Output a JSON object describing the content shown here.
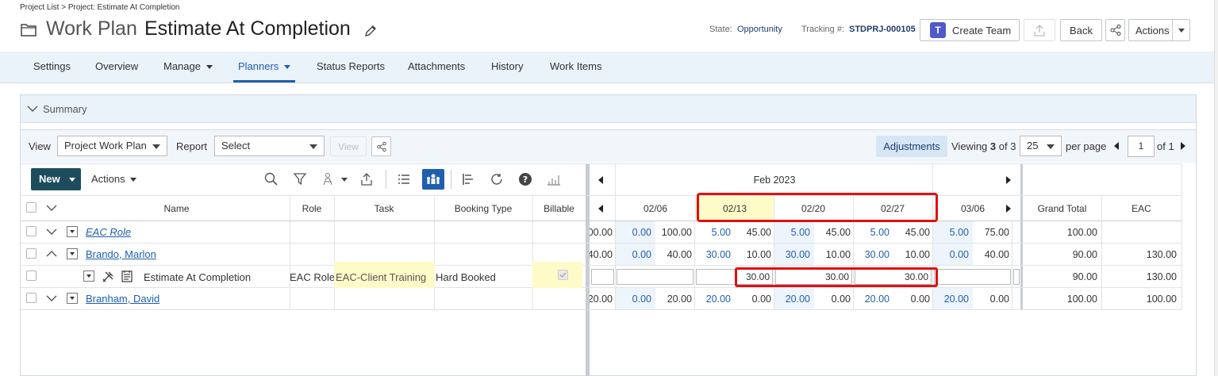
{
  "breadcrumb": "Project List > Project: Estimate At Completion",
  "header": {
    "section": "Work Plan",
    "title": "Estimate At Completion",
    "state_label": "State:",
    "state_value": "Opportunity",
    "tracking_label": "Tracking #:",
    "tracking_value": "STDPRJ-000105",
    "create_team": "Create Team",
    "back": "Back",
    "actions": "Actions"
  },
  "tabs": [
    "Settings",
    "Overview",
    "Manage",
    "Planners",
    "Status Reports",
    "Attachments",
    "History",
    "Work Items"
  ],
  "active_tab": "Planners",
  "summary_label": "Summary",
  "toolbar": {
    "view_label": "View",
    "view_value": "Project Work Plan",
    "report_label": "Report",
    "report_value": "Select",
    "view_button": "View",
    "adjustments": "Adjustments",
    "viewing_prefix": "Viewing ",
    "viewing_current": "3",
    "viewing_suffix": " of 3",
    "per_page_value": "25",
    "per_page_label": "per page",
    "page_value": "1",
    "page_of": "of 1"
  },
  "grid_toolbar": {
    "new": "New",
    "actions": "Actions"
  },
  "columns": {
    "name": "Name",
    "role": "Role",
    "task": "Task",
    "booking_type": "Booking Type",
    "billable": "Billable"
  },
  "timeline": {
    "month": "Feb 2023",
    "weeks": [
      "02/06",
      "02/13",
      "02/20",
      "02/27",
      "03/06"
    ],
    "grand_total": "Grand Total",
    "eac": "EAC"
  },
  "rows": [
    {
      "name": "EAC Role",
      "role": "",
      "task": "",
      "booking_type": "",
      "partial": "00.00",
      "weeks": [
        [
          "0.00",
          "100.00"
        ],
        [
          "5.00",
          "45.00"
        ],
        [
          "5.00",
          "45.00"
        ],
        [
          "5.00",
          "45.00"
        ],
        [
          "5.00",
          "75.00"
        ]
      ],
      "grand_total": "100.00",
      "eac": ""
    },
    {
      "name": "Brando, Marlon",
      "role": "",
      "task": "",
      "booking_type": "",
      "partial": "40.00",
      "weeks": [
        [
          "0.00",
          "40.00"
        ],
        [
          "30.00",
          "10.00"
        ],
        [
          "30.00",
          "10.00"
        ],
        [
          "30.00",
          "10.00"
        ],
        [
          "0.00",
          "40.00"
        ]
      ],
      "grand_total": "90.00",
      "eac": "130.00"
    },
    {
      "name": "Estimate At Completion",
      "role": "EAC Role",
      "task": "EAC-Client Training",
      "booking_type": "Hard Booked",
      "inputs": [
        "",
        "",
        "30.00",
        "30.00",
        "30.00",
        ""
      ],
      "grand_total": "90.00",
      "eac": "130.00"
    },
    {
      "name": "Branham, David",
      "role": "",
      "task": "",
      "booking_type": "",
      "partial": "20.00",
      "weeks": [
        [
          "0.00",
          "20.00"
        ],
        [
          "20.00",
          "0.00"
        ],
        [
          "20.00",
          "0.00"
        ],
        [
          "20.00",
          "0.00"
        ],
        [
          "20.00",
          "0.00"
        ]
      ],
      "grand_total": "100.00",
      "eac": "100.00"
    }
  ],
  "colors": {
    "accent": "#1f5fae",
    "highlight": "#fffbc8",
    "annotation": "#e01010",
    "nav_bg": "#eaf2fa",
    "new_btn": "#1d4d5c"
  }
}
